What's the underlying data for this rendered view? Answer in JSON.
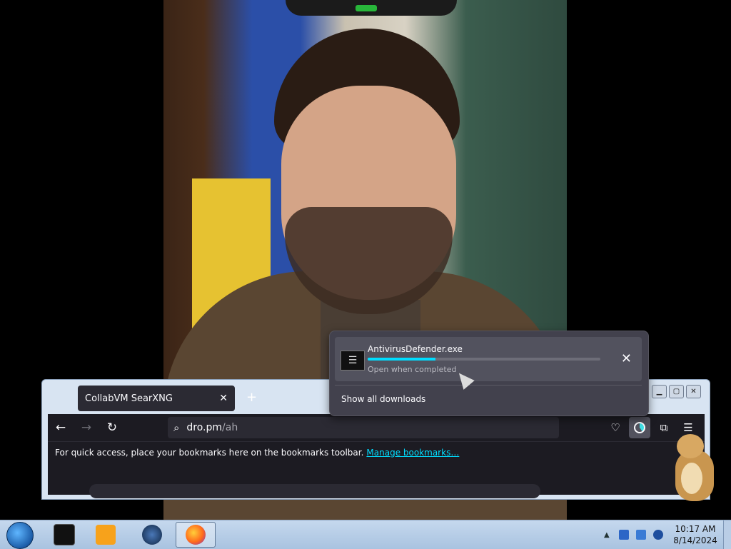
{
  "browser": {
    "tab_title": "CollabVM SearXNG",
    "tab_close": "✕",
    "new_tab": "+",
    "url_host": "dro.pm",
    "url_path": "/ah",
    "bookmarks_message": "For quick access, place your bookmarks here on the bookmarks toolbar.",
    "manage_bookmarks": "Manage bookmarks…"
  },
  "downloads_panel": {
    "file_name": "AntivirusDefender.exe",
    "status": "Open when completed",
    "progress": 0.29,
    "show_all": "Show all downloads"
  },
  "taskbar": {
    "time": "10:17 AM",
    "date": "8/14/2024",
    "apps": [
      "command-prompt-icon",
      "media-player-icon",
      "globe-icon",
      "firefox-icon"
    ]
  },
  "colors": {
    "accent": "#00ddff",
    "panel_bg": "#42414d",
    "toolbar_bg": "#1c1b22"
  }
}
